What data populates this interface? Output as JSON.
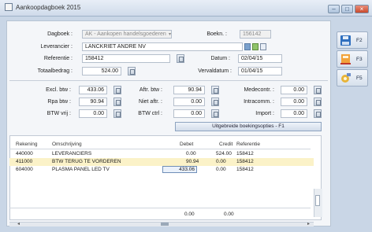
{
  "window": {
    "title": "Aankoopdagboek 2015",
    "min_label": "–",
    "max_label": "□",
    "close_label": "×"
  },
  "header": {
    "dagboek_label": "Dagboek :",
    "dagboek_value": "AK - Aankopen handelsgoederen",
    "boekn_label": "Boekn. :",
    "boekn_value": "156142",
    "leverancier_label": "Leverancier :",
    "leverancier_value": "LANCKRIET ANDRE NV",
    "referentie_label": "Referentie :",
    "referentie_value": "158412",
    "datum_label": "Datum :",
    "datum_value": "02/04/15",
    "totaalbedrag_label": "Totaalbedrag :",
    "totaalbedrag_value": "524.00",
    "vervaldatum_label": "Vervaldatum :",
    "vervaldatum_value": "01/04/15"
  },
  "amounts": {
    "excl_btw_label": "Excl. btw :",
    "excl_btw_value": "433.06",
    "rpa_label": "Rpa btw :",
    "rpa_value": "90.94",
    "btw_vrij_label": "BTW vrij :",
    "btw_vrij_value": "0.00",
    "aftr_btw_label": "Aftr. btw :",
    "aftr_btw_value": "90.94",
    "niet_aftr_label": "Niet aftr. :",
    "niet_aftr_value": "0.00",
    "btw_ctrl_label": "BTW ctrl :",
    "btw_ctrl_value": "0.00",
    "medecontr_label": "Medecontr. :",
    "medecontr_value": "0.00",
    "intracomm_label": "Intracomm. :",
    "intracomm_value": "0.00",
    "import_label": "Import :",
    "import_value": "0.00"
  },
  "uitgebreide_button": "Uitgebreide boekingsopties - F1",
  "table": {
    "headers": [
      "Rekening",
      "Omschrijving",
      "Debet",
      "Credit",
      "Referentie"
    ],
    "rows": [
      {
        "rekening": "440000",
        "omschrijving": "LEVERANCIERS",
        "debet": "0.00",
        "credit": "524.00",
        "referentie": "158412"
      },
      {
        "rekening": "411000",
        "omschrijving": "BTW TERUG TE VORDEREN",
        "debet": "90.94",
        "credit": "0.00",
        "referentie": "158412"
      },
      {
        "rekening": "604000",
        "omschrijving": "PLASMA PANEL LED TV",
        "debet": "433.06",
        "credit": "0.00",
        "referentie": "158412"
      }
    ],
    "total_debet": "0.00",
    "total_credit": "0.00"
  },
  "side_buttons": [
    {
      "icon": "save-icon",
      "key": "F2"
    },
    {
      "icon": "calculator-icon",
      "key": "F3"
    },
    {
      "icon": "tools-icon",
      "key": "F5"
    }
  ]
}
